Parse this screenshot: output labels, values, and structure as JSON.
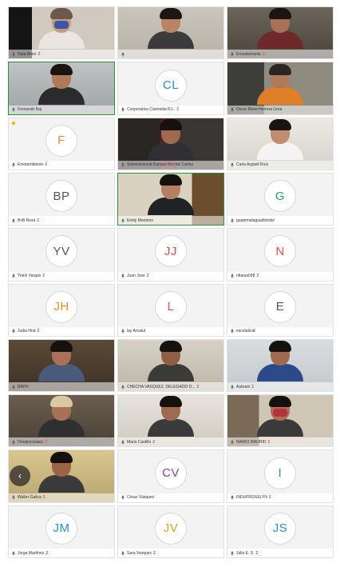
{
  "colors": {
    "accent_active": "#2f8f3a",
    "badge_red": "#d9534f",
    "avatar_blue": "#2a8ecf",
    "avatar_orange": "#e8902a",
    "avatar_green": "#27a86a",
    "avatar_red": "#e34f48",
    "avatar_gold": "#d9a31a",
    "avatar_purple": "#8b3fa8",
    "avatar_gray": "#555555"
  },
  "nav": {
    "prev_icon": "chevron-left-icon",
    "prev_glyph": "‹"
  },
  "tiles": [
    {
      "type": "video",
      "name": "Nata Beier",
      "badge": "2",
      "scene": "mask-woman"
    },
    {
      "type": "video",
      "name": "",
      "badge": "",
      "scene": "woman-glasses"
    },
    {
      "type": "video",
      "name": "Erosalamante",
      "badge": "2",
      "scene": "woman-dark"
    },
    {
      "type": "video",
      "name": "Fernando Baj",
      "badge": "",
      "scene": "young-man",
      "active": true
    },
    {
      "type": "avatar",
      "name": "Cooperativa Carmelita R.L.",
      "badge": "2",
      "initials": "CL",
      "color": "avatar_blue"
    },
    {
      "type": "video",
      "name": "Oscar Rene Herrera Lima",
      "badge": "",
      "scene": "man-orange"
    },
    {
      "type": "avatar",
      "name": "Emotambiente",
      "badge": "2",
      "initials": "F",
      "color": "avatar_orange",
      "dot": true
    },
    {
      "type": "video",
      "name": "Sobrevivencia Kansas Kinchel Carlos",
      "badge": "",
      "scene": "man-dark"
    },
    {
      "type": "video",
      "name": "Carla Argüell Ruíz",
      "badge": "",
      "scene": "woman-smile"
    },
    {
      "type": "avatar",
      "name": "BxB Rosa",
      "badge": "2",
      "initials": "BP",
      "color": "avatar_gray"
    },
    {
      "type": "video",
      "name": "Emily Monteiro",
      "badge": "",
      "scene": "man-office",
      "active": true
    },
    {
      "type": "avatar",
      "name": "guatemalaguadiondel",
      "badge": "",
      "initials": "G",
      "color": "avatar_green"
    },
    {
      "type": "avatar",
      "name": "Yoeni Vargas",
      "badge": "2",
      "initials": "YV",
      "color": "avatar_gray"
    },
    {
      "type": "avatar",
      "name": "Juan Jose",
      "badge": "2",
      "initials": "JJ",
      "color": "avatar_red"
    },
    {
      "type": "avatar",
      "name": "nfiarsa098",
      "badge": "2",
      "initials": "N",
      "color": "avatar_red"
    },
    {
      "type": "avatar",
      "name": "Judia Hnd",
      "badge": "2",
      "initials": "JH",
      "color": "avatar_orange"
    },
    {
      "type": "avatar",
      "name": "lay Arcalut",
      "badge": "",
      "initials": "L",
      "color": "avatar_red"
    },
    {
      "type": "avatar",
      "name": "escolaticall",
      "badge": "",
      "initials": "E",
      "color": "avatar_gray"
    },
    {
      "type": "video",
      "name": "BAPH",
      "badge": "",
      "scene": "man-frames"
    },
    {
      "type": "video",
      "name": "CHECHA VASQUEZ, DELEGADO D...",
      "badge": "2",
      "scene": "man-wall"
    },
    {
      "type": "video",
      "name": "Aubrain",
      "badge": "2",
      "scene": "man-blue"
    },
    {
      "type": "video",
      "name": "Onegiocosany",
      "badge": "2",
      "scene": "man-cap"
    },
    {
      "type": "video",
      "name": "Mario Castillo",
      "badge": "2",
      "scene": "man-room"
    },
    {
      "type": "video",
      "name": "MARIO MADRID",
      "badge": "2",
      "scene": "man-mask"
    },
    {
      "type": "video",
      "name": "Walter Galica",
      "badge": "2",
      "scene": "man-close"
    },
    {
      "type": "avatar",
      "name": "César Vásquez",
      "badge": "",
      "initials": "CV",
      "color": "avatar_purple"
    },
    {
      "type": "avatar",
      "name": "INDUFROSSLYN",
      "badge": "2",
      "initials": "I",
      "color": "avatar_green"
    },
    {
      "type": "avatar",
      "name": "Jorge Martínez",
      "badge": "2",
      "initials": "JM",
      "color": "avatar_blue"
    },
    {
      "type": "avatar",
      "name": "Sara Vasquez",
      "badge": "2",
      "initials": "JV",
      "color": "avatar_gold"
    },
    {
      "type": "avatar",
      "name": "Julio E. S.",
      "badge": "2",
      "initials": "JS",
      "color": "avatar_blue"
    }
  ]
}
